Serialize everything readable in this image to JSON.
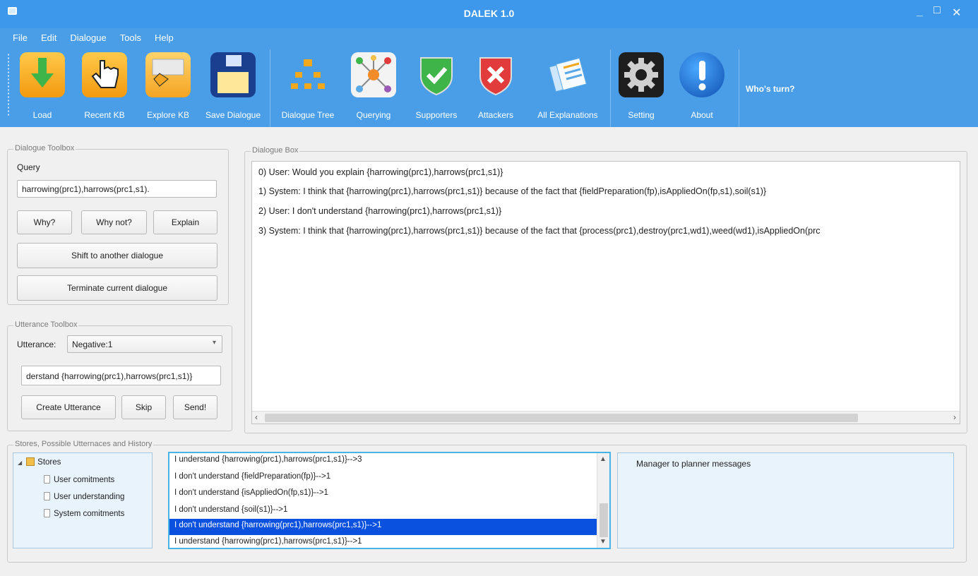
{
  "window": {
    "title": "DALEK 1.0",
    "controls": [
      "_",
      "□",
      "✕"
    ]
  },
  "menu": [
    "File",
    "Edit",
    "Dialogue",
    "Tools",
    "Help"
  ],
  "toolbar": {
    "items": [
      {
        "label": "Load",
        "icon": "load-icon",
        "color": "#f6a623"
      },
      {
        "label": "Recent KB",
        "icon": "hand-pointer-icon",
        "color": "#f6a623"
      },
      {
        "label": "Explore KB",
        "icon": "folder-icon",
        "color": "#f6a623"
      },
      {
        "label": "Save Dialogue",
        "icon": "floppy-disk-icon",
        "color": "#1b3f8f"
      },
      {
        "label": "Dialogue Tree",
        "icon": "org-chart-icon",
        "color": "#f2a81d"
      },
      {
        "label": "Querying",
        "icon": "network-icon",
        "color": "#ffffff"
      },
      {
        "label": "Supporters",
        "icon": "shield-check-icon",
        "color": "#3fb449"
      },
      {
        "label": "Attackers",
        "icon": "shield-cross-icon",
        "color": "#e23b3b"
      },
      {
        "label": "All Explanations",
        "icon": "documents-icon",
        "color": "#5aa9e6"
      },
      {
        "label": "Setting",
        "icon": "gear-icon",
        "color": "#2b2b2b"
      },
      {
        "label": "About",
        "icon": "info-exclamation-icon",
        "color": "#1f6fd0"
      }
    ],
    "whos_turn": "Who's turn?"
  },
  "dialogue_toolbox": {
    "legend": "Dialogue Toolbox",
    "query_label": "Query",
    "query_value": "harrowing(prc1),harrows(prc1,s1).",
    "why": "Why?",
    "why_not": "Why not?",
    "explain": "Explain",
    "shift": "Shift to another dialogue",
    "terminate": "Terminate current dialogue"
  },
  "utterance_toolbox": {
    "legend": "Utterance Toolbox",
    "utterance_label": "Utterance:",
    "utterance_selected": "Negative:1",
    "text_value": "derstand {harrowing(prc1),harrows(prc1,s1)}",
    "create": "Create Utterance",
    "skip": "Skip",
    "send": "Send!"
  },
  "dialogue_box": {
    "legend": "Dialogue Box",
    "lines": [
      "0) User: Would you explain {harrowing(prc1),harrows(prc1,s1)}",
      "1) System: I think that {harrowing(prc1),harrows(prc1,s1)} because of the fact that {fieldPreparation(fp),isAppliedOn(fp,s1),soil(s1)}",
      "2) User: I don't understand {harrowing(prc1),harrows(prc1,s1)}",
      "3) System: I think that {harrowing(prc1),harrows(prc1,s1)} because of the fact that {process(prc1),destroy(prc1,wd1),weed(wd1),isAppliedOn(prc"
    ]
  },
  "stores_panel": {
    "legend": "Stores, Possible Utternaces and History",
    "tree": {
      "root": "Stores",
      "children": [
        "User comitments",
        "User understanding",
        "System comitments"
      ]
    },
    "utterances": [
      "I understand {harrowing(prc1),harrows(prc1,s1)}-->3",
      "I don't understand {fieldPreparation(fp)}-->1",
      "I don't understand {isAppliedOn(fp,s1)}-->1",
      "I don't understand {soil(s1)}-->1",
      "I don't understand {harrowing(prc1),harrows(prc1,s1)}-->1",
      "I understand {harrowing(prc1),harrows(prc1,s1)}-->1"
    ],
    "selected_index": 4,
    "messages_title": "Manager to planner messages"
  }
}
